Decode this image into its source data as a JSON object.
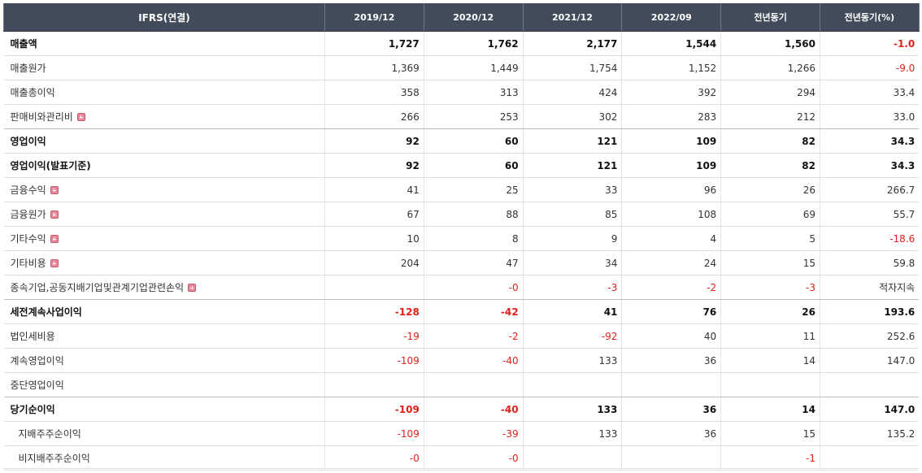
{
  "header": {
    "label_col": "IFRS(연결)",
    "columns": [
      "2019/12",
      "2020/12",
      "2021/12",
      "2022/09",
      "전년동기",
      "전년동기(%)"
    ]
  },
  "icons": {
    "expand": "plus-box-icon"
  },
  "colors": {
    "header_bg": "#424b5a",
    "negative": "#e0201b"
  },
  "rows": [
    {
      "label": "매출액",
      "bold": true,
      "expand": false,
      "sub": false,
      "values": [
        "1,727",
        "1,762",
        "2,177",
        "1,544",
        "1,560",
        "-1.0"
      ]
    },
    {
      "label": "매출원가",
      "bold": false,
      "expand": false,
      "sub": false,
      "values": [
        "1,369",
        "1,449",
        "1,754",
        "1,152",
        "1,266",
        "-9.0"
      ]
    },
    {
      "label": "매출총이익",
      "bold": false,
      "expand": false,
      "sub": false,
      "values": [
        "358",
        "313",
        "424",
        "392",
        "294",
        "33.4"
      ]
    },
    {
      "label": "판매비와관리비",
      "bold": false,
      "expand": true,
      "sub": false,
      "values": [
        "266",
        "253",
        "302",
        "283",
        "212",
        "33.0"
      ]
    },
    {
      "label": "영업이익",
      "bold": true,
      "expand": false,
      "sub": false,
      "values": [
        "92",
        "60",
        "121",
        "109",
        "82",
        "34.3"
      ]
    },
    {
      "label": "영업이익(발표기준)",
      "bold": true,
      "expand": false,
      "sub": false,
      "values": [
        "92",
        "60",
        "121",
        "109",
        "82",
        "34.3"
      ]
    },
    {
      "label": "금융수익",
      "bold": false,
      "expand": true,
      "sub": false,
      "values": [
        "41",
        "25",
        "33",
        "96",
        "26",
        "266.7"
      ]
    },
    {
      "label": "금융원가",
      "bold": false,
      "expand": true,
      "sub": false,
      "values": [
        "67",
        "88",
        "85",
        "108",
        "69",
        "55.7"
      ]
    },
    {
      "label": "기타수익",
      "bold": false,
      "expand": true,
      "sub": false,
      "values": [
        "10",
        "8",
        "9",
        "4",
        "5",
        "-18.6"
      ]
    },
    {
      "label": "기타비용",
      "bold": false,
      "expand": true,
      "sub": false,
      "values": [
        "204",
        "47",
        "34",
        "24",
        "15",
        "59.8"
      ]
    },
    {
      "label": "종속기업,공동지배기업및관계기업관련손익",
      "bold": false,
      "expand": true,
      "sub": false,
      "values": [
        "",
        "-0",
        "-3",
        "-2",
        "-3",
        "적자지속"
      ]
    },
    {
      "label": "세전계속사업이익",
      "bold": true,
      "expand": false,
      "sub": false,
      "values": [
        "-128",
        "-42",
        "41",
        "76",
        "26",
        "193.6"
      ]
    },
    {
      "label": "법인세비용",
      "bold": false,
      "expand": false,
      "sub": false,
      "values": [
        "-19",
        "-2",
        "-92",
        "40",
        "11",
        "252.6"
      ]
    },
    {
      "label": "계속영업이익",
      "bold": false,
      "expand": false,
      "sub": false,
      "values": [
        "-109",
        "-40",
        "133",
        "36",
        "14",
        "147.0"
      ]
    },
    {
      "label": "중단영업이익",
      "bold": false,
      "expand": false,
      "sub": false,
      "values": [
        "",
        "",
        "",
        "",
        "",
        ""
      ]
    },
    {
      "label": "당기순이익",
      "bold": true,
      "expand": false,
      "sub": false,
      "values": [
        "-109",
        "-40",
        "133",
        "36",
        "14",
        "147.0"
      ]
    },
    {
      "label": "지배주주순이익",
      "bold": false,
      "expand": false,
      "sub": true,
      "values": [
        "-109",
        "-39",
        "133",
        "36",
        "15",
        "135.2"
      ]
    },
    {
      "label": "비지배주주순이익",
      "bold": false,
      "expand": false,
      "sub": true,
      "values": [
        "-0",
        "-0",
        "",
        "",
        "-1",
        ""
      ]
    }
  ]
}
